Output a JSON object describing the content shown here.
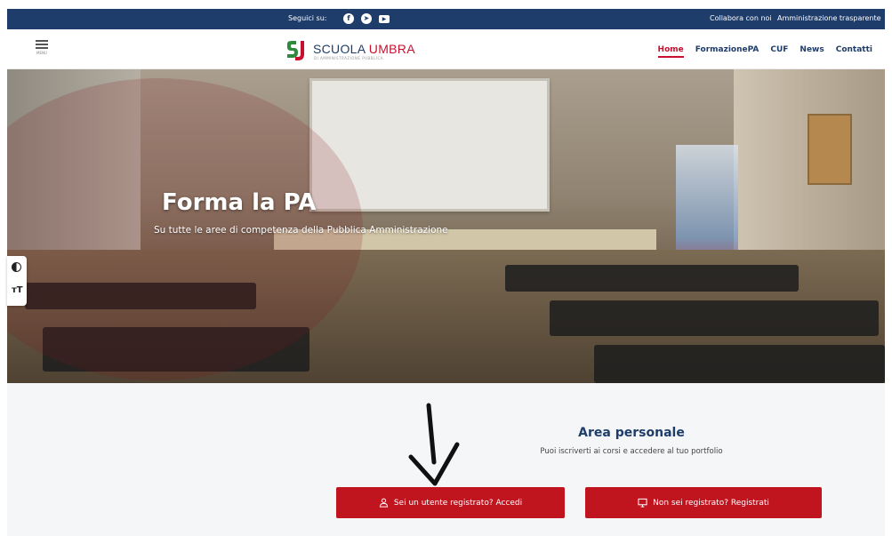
{
  "topbar": {
    "follow_label": "Seguici su:",
    "social": [
      {
        "icon": "facebook-icon",
        "glyph": "f"
      },
      {
        "icon": "telegram-icon",
        "glyph": "➤"
      },
      {
        "icon": "youtube-icon",
        "glyph": "▶"
      }
    ],
    "links": [
      "Collabora con noi",
      "Amministrazione trasparente"
    ]
  },
  "header": {
    "menu_label": "MENU",
    "logo": {
      "name_prefix": "SCUOLA ",
      "name_accent": "UMBRA",
      "subtitle": "DI AMMINISTRAZIONE PUBBLICA"
    },
    "nav": [
      {
        "label": "Home",
        "active": true
      },
      {
        "label": "FormazionePA",
        "active": false
      },
      {
        "label": "CUF",
        "active": false
      },
      {
        "label": "News",
        "active": false
      },
      {
        "label": "Contatti",
        "active": false
      }
    ]
  },
  "hero": {
    "title": "Forma la PA",
    "subtitle": "Su tutte le aree di competenza della Pubblica Amministrazione"
  },
  "accessibility": {
    "contrast_icon": "contrast-icon",
    "text_size_glyph": "тT"
  },
  "area": {
    "title": "Area personale",
    "subtitle": "Puoi iscriverti ai corsi e accedere al tuo portfolio",
    "login_label": "Sei un utente registrato? Accedi",
    "register_label": "Non sei registrato? Registrati"
  },
  "colors": {
    "brand_blue": "#1f3d6b",
    "brand_red": "#c8102e",
    "button_red": "#c0141f"
  }
}
